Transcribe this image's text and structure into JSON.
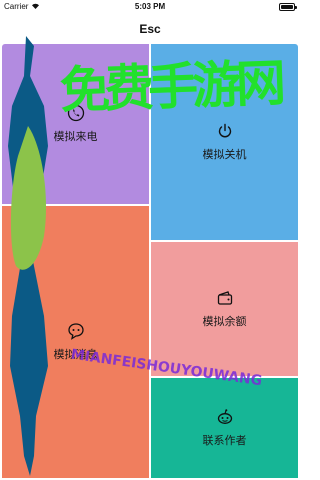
{
  "status_bar": {
    "carrier": "Carrier",
    "time": "5:03 PM"
  },
  "nav": {
    "title": "Esc"
  },
  "tiles": [
    {
      "label": "模拟来电",
      "icon": "phone-icon",
      "color": "#b28be0"
    },
    {
      "label": "模拟关机",
      "icon": "power-icon",
      "color": "#5aaee6"
    },
    {
      "label": "模拟消息",
      "icon": "message-icon",
      "color": "#f07e5e"
    },
    {
      "label": "模拟余额",
      "icon": "wallet-icon",
      "color": "#f19d9d"
    },
    {
      "label": "联系作者",
      "icon": "robot-icon",
      "color": "#16b696"
    }
  ],
  "watermark": {
    "big": "免费手游网",
    "small": "MIANFEISHOUYOUWANG"
  }
}
